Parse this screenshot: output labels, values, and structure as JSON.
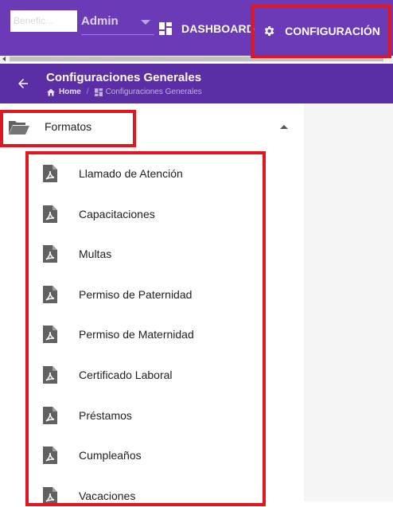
{
  "topbar": {
    "workspace_input_value": "Benefic...",
    "workspace_select_value": "Admin",
    "nav": {
      "dashboard_label": "DASHBOARD",
      "dashboard_icon": "dashboard-grid-icon",
      "config_label": "CONFIGURACIÓN",
      "config_icon": "gear-icon"
    }
  },
  "header": {
    "title": "Configuraciones Generales",
    "breadcrumb": {
      "home_label": "Home",
      "separator": "/",
      "current_label": "Configuraciones Generales"
    }
  },
  "sidebar": {
    "folder": {
      "label": "Formatos",
      "icon": "folder-open-icon",
      "expanded": true
    },
    "items": [
      {
        "label": "Llamado de Atención",
        "icon": "pdf-file-icon"
      },
      {
        "label": "Capacitaciones",
        "icon": "pdf-file-icon"
      },
      {
        "label": "Multas",
        "icon": "pdf-file-icon"
      },
      {
        "label": "Permiso de Paternidad",
        "icon": "pdf-file-icon"
      },
      {
        "label": "Permiso de Maternidad",
        "icon": "pdf-file-icon"
      },
      {
        "label": "Certificado Laboral",
        "icon": "pdf-file-icon"
      },
      {
        "label": "Préstamos",
        "icon": "pdf-file-icon"
      },
      {
        "label": "Cumpleaños",
        "icon": "pdf-file-icon"
      },
      {
        "label": "Vacaciones",
        "icon": "pdf-file-icon"
      }
    ]
  },
  "colors": {
    "topbar": "#6a3ab7",
    "headerbar": "#5c2ea5",
    "highlight": "#e0171f",
    "icon_gray": "#616161"
  }
}
